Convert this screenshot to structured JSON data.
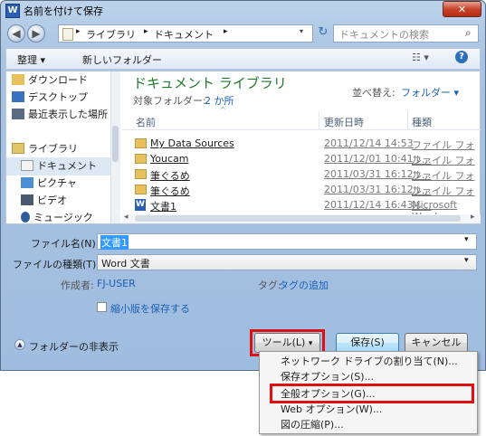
{
  "window": {
    "title": "名前を付けて保存",
    "app_icon": "W",
    "close": "✕"
  },
  "address": {
    "path": [
      "ライブラリ",
      "ドキュメント"
    ],
    "search_placeholder": "ドキュメントの検索"
  },
  "toolbar": {
    "organize": "整理 ▾",
    "new_folder": "新しいフォルダー"
  },
  "nav": {
    "items": [
      {
        "label": "ダウンロード",
        "icon": "download-folder-icon"
      },
      {
        "label": "デスクトップ",
        "icon": "desktop-icon"
      },
      {
        "label": "最近表示した場所",
        "icon": "recent-places-icon"
      },
      {
        "label": "ライブラリ",
        "icon": "library-icon"
      },
      {
        "label": "ドキュメント",
        "icon": "documents-icon"
      },
      {
        "label": "ピクチャ",
        "icon": "pictures-icon"
      },
      {
        "label": "ビデオ",
        "icon": "video-icon"
      },
      {
        "label": "ミュージック",
        "icon": "music-icon"
      }
    ]
  },
  "library": {
    "title": "ドキュメント ライブラリ",
    "target_label": "対象フォルダー:",
    "target_value": "2 か所",
    "sort_label": "並べ替え:",
    "sort_value": "フォルダー ▾"
  },
  "columns": {
    "name": "名前",
    "date": "更新日時",
    "type": "種類"
  },
  "files": [
    {
      "name": "My Data Sources",
      "date": "2011/12/14 14:53",
      "type": "ファイル フォル..."
    },
    {
      "name": "Youcam",
      "date": "2011/12/01 10:41",
      "type": "ファイル フォル..."
    },
    {
      "name": "筆ぐるめ",
      "date": "2011/03/31 16:12",
      "type": "ファイル フォル..."
    },
    {
      "name": "筆ぐるめ",
      "date": "2011/03/31 16:12",
      "type": "ファイル フォル..."
    },
    {
      "name": "文書1",
      "date": "2011/12/14 16:43",
      "type": "Microsoft Word ..."
    }
  ],
  "form": {
    "filename_label": "ファイル名(N):",
    "filename_value": "文書1",
    "filetype_label": "ファイルの種類(T):",
    "filetype_value": "Word 文書",
    "author_label": "作成者:",
    "author_value": "FJ-USER",
    "tags_label": "タグ:",
    "tags_value": "タグの追加",
    "thumbnail_label": "縮小版を保存する"
  },
  "footer": {
    "hide_folders": "フォルダーの非表示",
    "tools": "ツール(L)",
    "save": "保存(S)",
    "cancel": "キャンセル"
  },
  "menu": {
    "items": [
      "ネットワーク ドライブの割り当て(N)...",
      "保存オプション(S)...",
      "全般オプション(G)...",
      "Web オプション(W)...",
      "図の圧縮(P)..."
    ]
  },
  "colors": {
    "accent": "#1e7a2e",
    "link": "#1a5fb4",
    "highlight": "#e01010"
  }
}
